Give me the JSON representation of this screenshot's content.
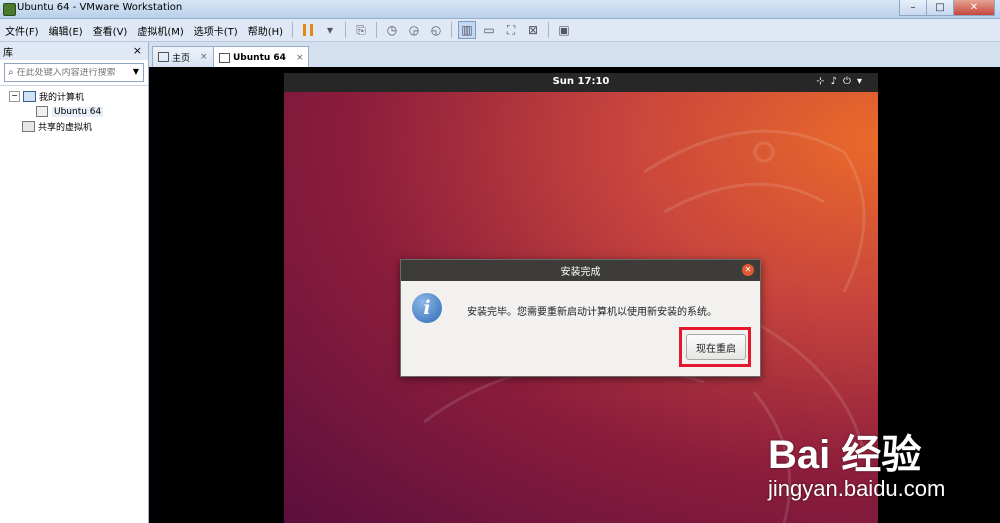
{
  "window": {
    "title": "Ubuntu 64 - VMware Workstation"
  },
  "menubar": {
    "items": [
      "文件(F)",
      "编辑(E)",
      "查看(V)",
      "虚拟机(M)",
      "选项卡(T)",
      "帮助(H)"
    ]
  },
  "sidebar": {
    "header": "库",
    "close": "×",
    "search_placeholder": "在此处键入内容进行搜索",
    "tree": {
      "root": "我的计算机",
      "vm": "Ubuntu 64",
      "shared": "共享的虚拟机"
    }
  },
  "tabs": [
    {
      "label": "主页",
      "close": "×"
    },
    {
      "label": "Ubuntu 64",
      "close": "×"
    }
  ],
  "guest": {
    "clock": "Sun 17:10",
    "dialog": {
      "title": "安装完成",
      "message": "安装完毕。您需要重新启动计算机以使用新安装的系统。",
      "button": "现在重启",
      "info_glyph": "i"
    }
  },
  "watermark": {
    "main": "Bai 经验",
    "sub": "jingyan.baidu.com"
  }
}
